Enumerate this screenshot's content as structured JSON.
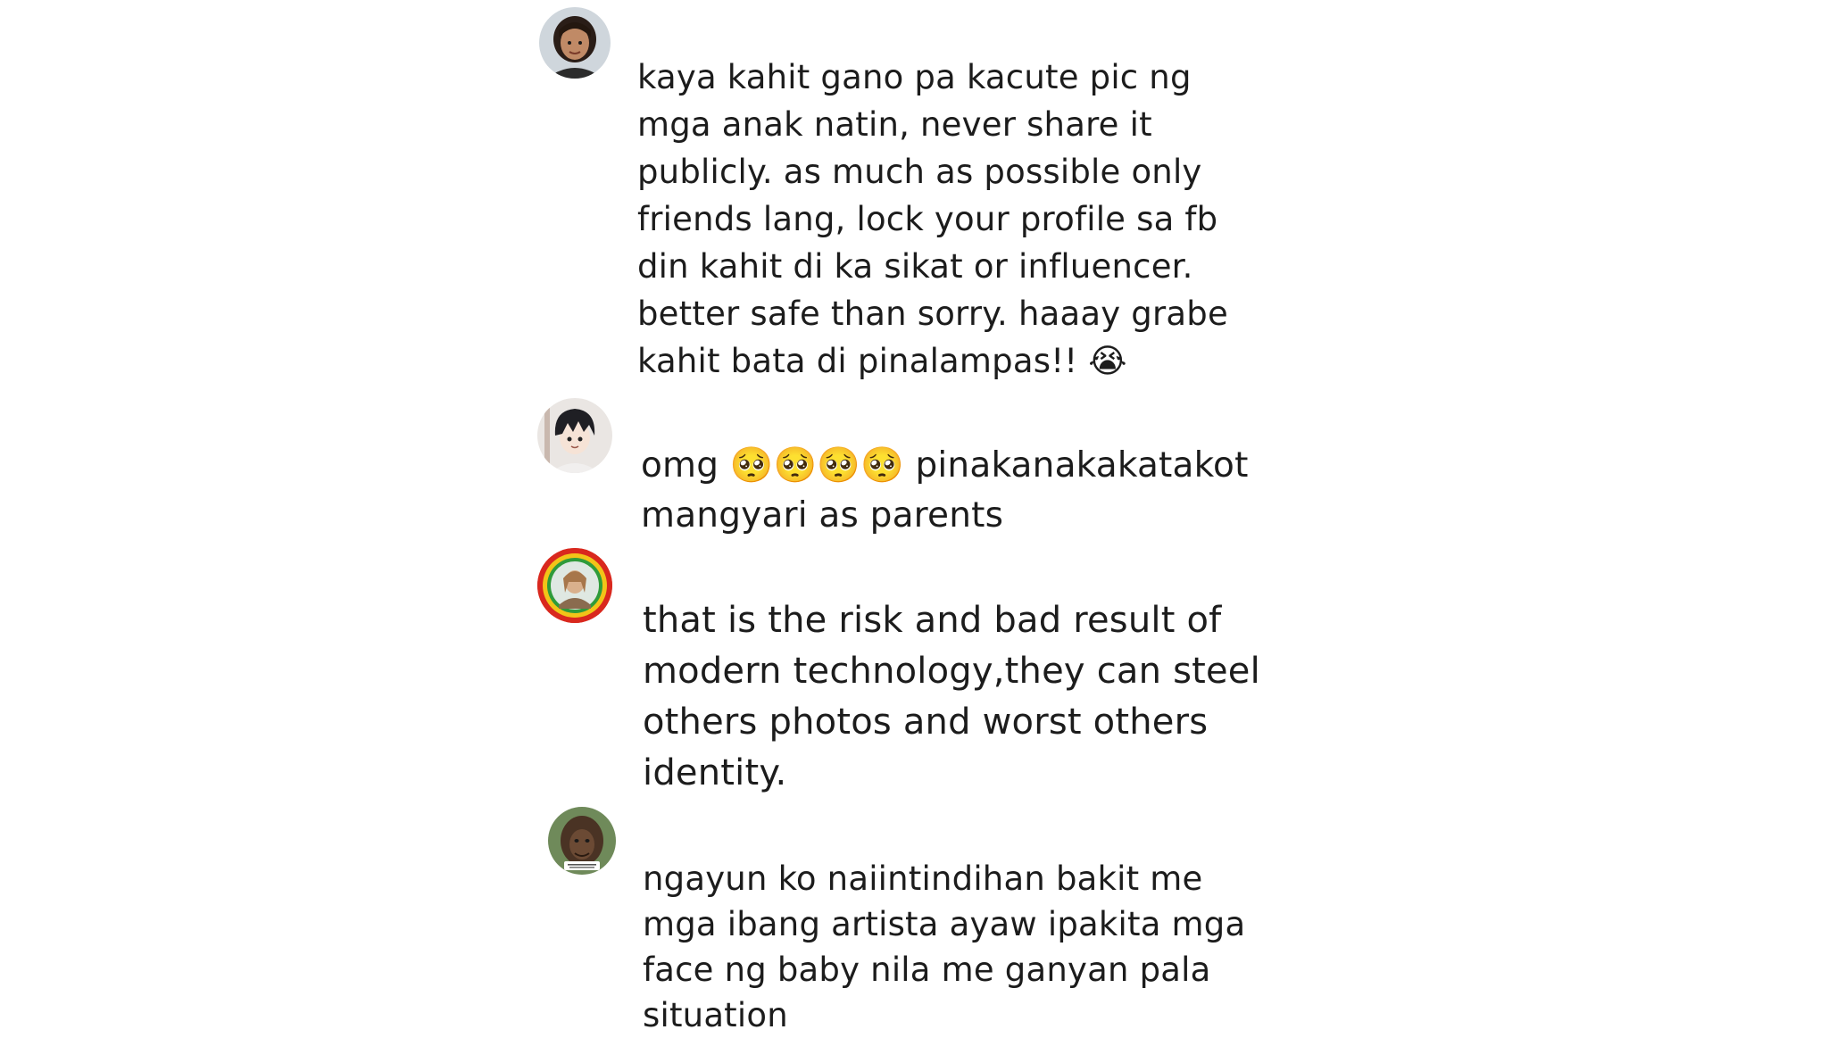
{
  "comments": [
    {
      "avatar_icon": "user-avatar-icon",
      "text": "kaya kahit gano pa kacute pic ng\nmga anak natin, never share it\npublicly. as much as possible only\nfriends lang, lock your profile sa fb\ndin kahit di ka sikat or influencer.\nbetter safe than sorry. haaay grabe\nkahit bata di pinalampas!! 😭"
    },
    {
      "avatar_icon": "anime-avatar-icon",
      "text": "omg 🥺🥺🥺🥺 pinakanakakatakot\nmangyari as parents"
    },
    {
      "avatar_icon": "ringed-avatar-icon",
      "text": "that is the risk and bad result of\nmodern technology,they can steel\nothers photos and worst others\nidentity."
    },
    {
      "avatar_icon": "caveman-avatar-icon",
      "text": "ngayun ko naiintindihan bakit me\nmga ibang artista ayaw ipakita mga\nface ng baby nila me ganyan pala\nsituation"
    }
  ],
  "colors": {
    "text": "#1c1c1c",
    "background": "#ffffff",
    "ring_red": "#d9281e",
    "ring_green": "#2f9b3a",
    "ring_yellow": "#f2c418"
  }
}
